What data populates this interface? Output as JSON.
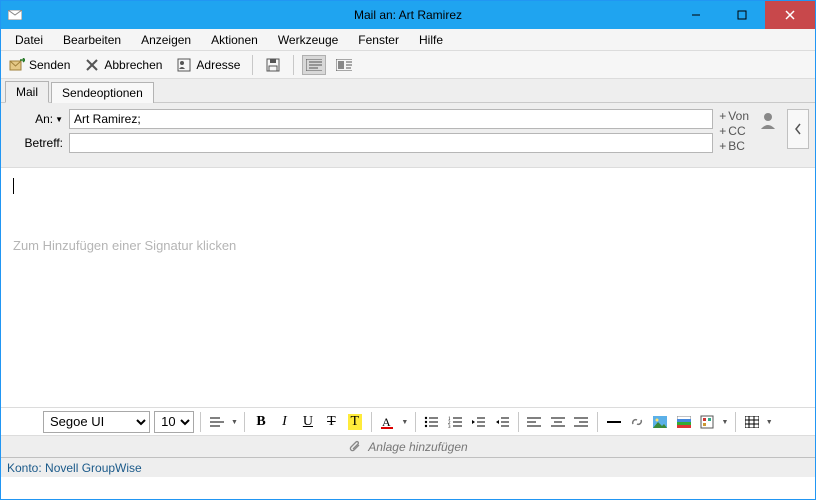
{
  "window": {
    "title": "Mail an: Art Ramirez"
  },
  "menu": [
    "Datei",
    "Bearbeiten",
    "Anzeigen",
    "Aktionen",
    "Werkzeuge",
    "Fenster",
    "Hilfe"
  ],
  "toolbar": {
    "send": "Senden",
    "cancel": "Abbrechen",
    "address": "Adresse"
  },
  "tabs": {
    "mail": "Mail",
    "sendopts": "Sendeoptionen"
  },
  "fields": {
    "to_label": "An:",
    "to_value": "Art Ramirez;",
    "subject_label": "Betreff:",
    "subject_value": "",
    "add_von": "Von",
    "add_cc": "CC",
    "add_bc": "BC"
  },
  "body": {
    "signature_hint": "Zum Hinzufügen einer Signatur klicken"
  },
  "format": {
    "font": "Segoe UI",
    "size": "10",
    "bold": "B",
    "italic": "I",
    "underline": "U",
    "strike": "T",
    "highlight": "T"
  },
  "attach": {
    "label": "Anlage hinzufügen"
  },
  "status": {
    "account": "Konto: Novell GroupWise"
  }
}
